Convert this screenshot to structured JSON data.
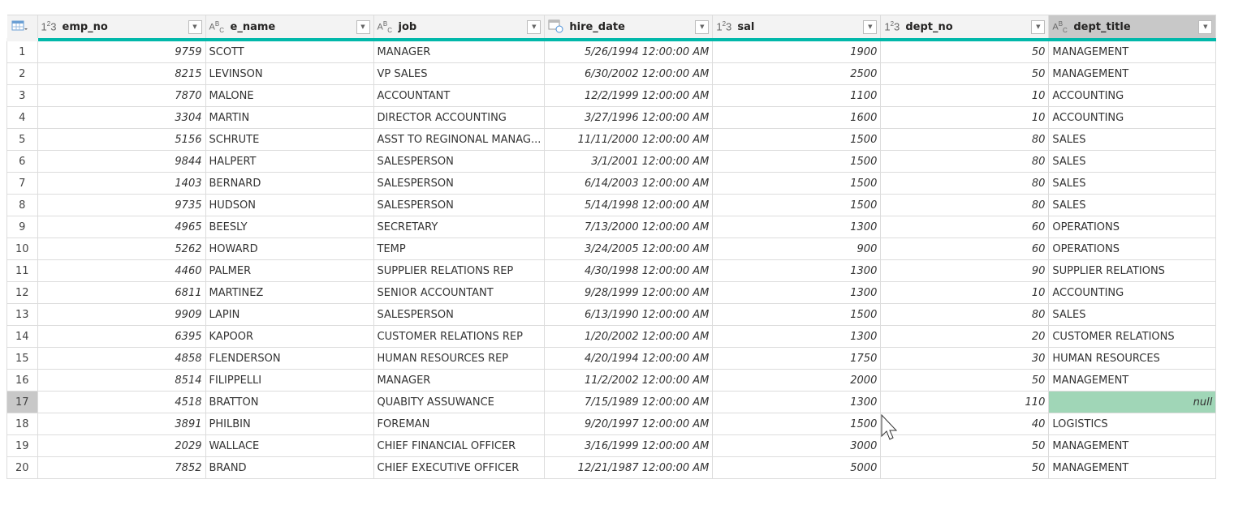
{
  "columns": [
    {
      "name": "emp_no",
      "type": "1²3",
      "kind": "num"
    },
    {
      "name": "e_name",
      "type": "ABC",
      "kind": "text"
    },
    {
      "name": "job",
      "type": "ABC",
      "kind": "text"
    },
    {
      "name": "hire_date",
      "type": "date",
      "kind": "num"
    },
    {
      "name": "sal",
      "type": "1²3",
      "kind": "num"
    },
    {
      "name": "dept_no",
      "type": "1²3",
      "kind": "num"
    },
    {
      "name": "dept_title",
      "type": "ABC",
      "kind": "text"
    }
  ],
  "selected_row": 17,
  "selected_column": "dept_title",
  "rows": [
    [
      "9759",
      "SCOTT",
      "MANAGER",
      "5/26/1994 12:00:00 AM",
      "1900",
      "50",
      "MANAGEMENT"
    ],
    [
      "8215",
      "LEVINSON",
      "VP SALES",
      "6/30/2002 12:00:00 AM",
      "2500",
      "50",
      "MANAGEMENT"
    ],
    [
      "7870",
      "MALONE",
      "ACCOUNTANT",
      "12/2/1999 12:00:00 AM",
      "1100",
      "10",
      "ACCOUNTING"
    ],
    [
      "3304",
      "MARTIN",
      "DIRECTOR ACCOUNTING",
      "3/27/1996 12:00:00 AM",
      "1600",
      "10",
      "ACCOUNTING"
    ],
    [
      "5156",
      "SCHRUTE",
      "ASST TO REGINONAL MANAG...",
      "11/11/2000 12:00:00 AM",
      "1500",
      "80",
      "SALES"
    ],
    [
      "9844",
      "HALPERT",
      "SALESPERSON",
      "3/1/2001 12:00:00 AM",
      "1500",
      "80",
      "SALES"
    ],
    [
      "1403",
      "BERNARD",
      "SALESPERSON",
      "6/14/2003 12:00:00 AM",
      "1500",
      "80",
      "SALES"
    ],
    [
      "9735",
      "HUDSON",
      "SALESPERSON",
      "5/14/1998 12:00:00 AM",
      "1500",
      "80",
      "SALES"
    ],
    [
      "4965",
      "BEESLY",
      "SECRETARY",
      "7/13/2000 12:00:00 AM",
      "1300",
      "60",
      "OPERATIONS"
    ],
    [
      "5262",
      "HOWARD",
      "TEMP",
      "3/24/2005 12:00:00 AM",
      "900",
      "60",
      "OPERATIONS"
    ],
    [
      "4460",
      "PALMER",
      "SUPPLIER RELATIONS REP",
      "4/30/1998 12:00:00 AM",
      "1300",
      "90",
      "SUPPLIER RELATIONS"
    ],
    [
      "6811",
      "MARTINEZ",
      "SENIOR ACCOUNTANT",
      "9/28/1999 12:00:00 AM",
      "1300",
      "10",
      "ACCOUNTING"
    ],
    [
      "9909",
      "LAPIN",
      "SALESPERSON",
      "6/13/1990 12:00:00 AM",
      "1500",
      "80",
      "SALES"
    ],
    [
      "6395",
      "KAPOOR",
      "CUSTOMER RELATIONS REP",
      "1/20/2002 12:00:00 AM",
      "1300",
      "20",
      "CUSTOMER RELATIONS"
    ],
    [
      "4858",
      "FLENDERSON",
      "HUMAN RESOURCES REP",
      "4/20/1994 12:00:00 AM",
      "1750",
      "30",
      "HUMAN RESOURCES"
    ],
    [
      "8514",
      "FILIPPELLI",
      "MANAGER",
      "11/2/2002 12:00:00 AM",
      "2000",
      "50",
      "MANAGEMENT"
    ],
    [
      "4518",
      "BRATTON",
      "QUABITY ASSUWANCE",
      "7/15/1989 12:00:00 AM",
      "1300",
      "110",
      "null"
    ],
    [
      "3891",
      "PHILBIN",
      "FOREMAN",
      "9/20/1997 12:00:00 AM",
      "1500",
      "40",
      "LOGISTICS"
    ],
    [
      "2029",
      "WALLACE",
      "CHIEF FINANCIAL OFFICER",
      "3/16/1999 12:00:00 AM",
      "3000",
      "50",
      "MANAGEMENT"
    ],
    [
      "7852",
      "BRAND",
      "CHIEF EXECUTIVE OFFICER",
      "12/21/1987 12:00:00 AM",
      "5000",
      "50",
      "MANAGEMENT"
    ]
  ],
  "colors": {
    "accent": "#01b8aa",
    "null_cell": "#a0d6b7",
    "selected": "#c8c8c8"
  }
}
